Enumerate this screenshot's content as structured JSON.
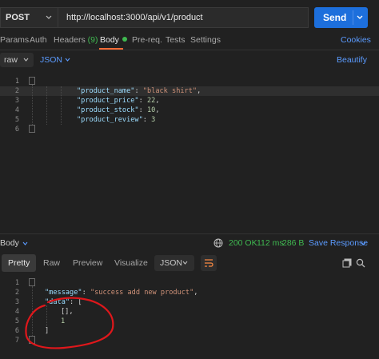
{
  "request": {
    "method": "POST",
    "url": "http://localhost:3000/api/v1/product",
    "send_label": "Send"
  },
  "tabs": {
    "params": "Params",
    "auth": "Auth",
    "headers": "Headers",
    "headers_count": "(9)",
    "body": "Body",
    "prereq": "Pre-req.",
    "tests": "Tests",
    "settings": "Settings",
    "cookies": "Cookies"
  },
  "body_options": {
    "mode": "raw",
    "format": "JSON",
    "beautify": "Beautify"
  },
  "request_body": {
    "line_numbers": [
      "1",
      "2",
      "3",
      "4",
      "5",
      "6"
    ],
    "fields": [
      {
        "key": "\"product_name\"",
        "value": "\"black shirt\"",
        "trail": ","
      },
      {
        "key": "\"product_price\"",
        "value": "22",
        "trail": ","
      },
      {
        "key": "\"product_stock\"",
        "value": "10",
        "trail": ","
      },
      {
        "key": "\"product_review\"",
        "value": "3",
        "trail": ""
      }
    ]
  },
  "response": {
    "label": "Body",
    "status": "200 OK",
    "time": "112 ms",
    "size": "286 B",
    "save": "Save Response"
  },
  "response_tabs": {
    "pretty": "Pretty",
    "raw": "Raw",
    "preview": "Preview",
    "visualize": "Visualize",
    "format": "JSON"
  },
  "response_body": {
    "line_numbers": [
      "1",
      "2",
      "3",
      "4",
      "5",
      "6",
      "7"
    ],
    "message_key": "\"message\"",
    "message_value": "\"success add new product\"",
    "data_key": "\"data\"",
    "open_bracket": "[",
    "empty_array": "[],",
    "number_value": "1",
    "close_bracket": "]"
  },
  "colors": {
    "accent_send": "#1d6fdc",
    "active_tab": "#ff6c37",
    "status_green": "#3fb950",
    "link_blue": "#5b9bff",
    "annotation_red": "#e0171b"
  }
}
